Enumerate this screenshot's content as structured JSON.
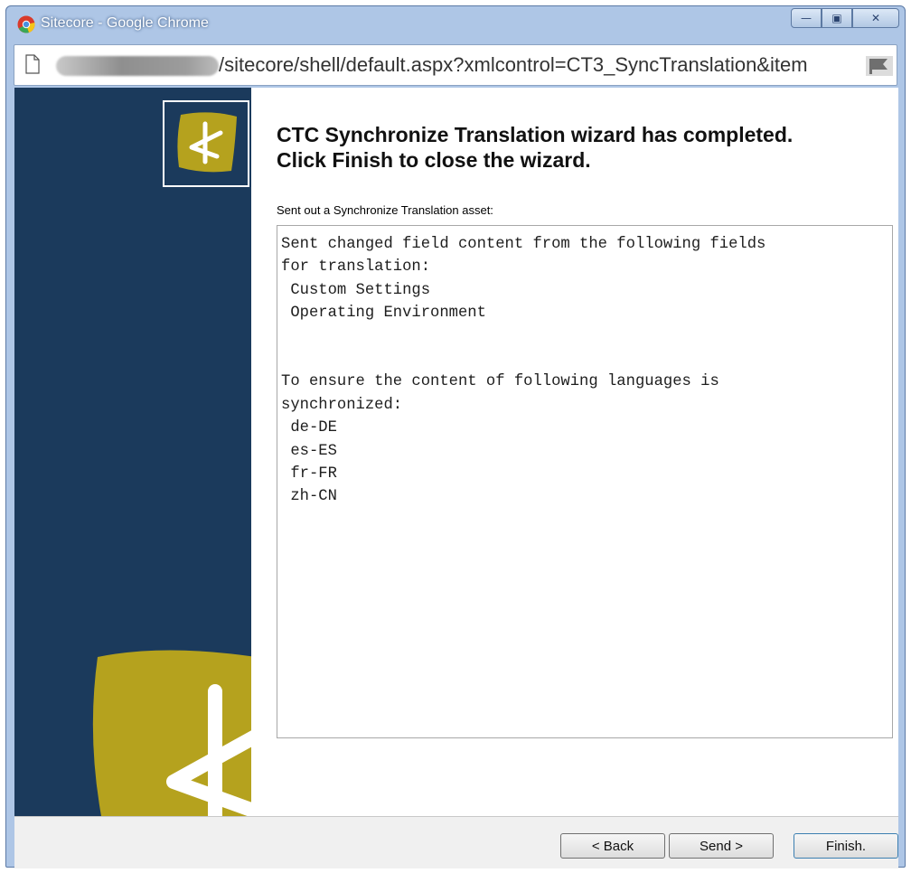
{
  "window": {
    "title": "Sitecore - Google Chrome",
    "controls": {
      "minimize": "—",
      "maximize": "▣",
      "close": "✕"
    }
  },
  "addressbar": {
    "url_visible": "/sitecore/shell/default.aspx?xmlcontrol=CT3_SyncTranslation&item"
  },
  "wizard": {
    "heading_line1": "CTC Synchronize Translation wizard has completed.",
    "heading_line2": "Click Finish to close the wizard.",
    "asset_label": "Sent out a Synchronize Translation asset:",
    "details": "Sent changed field content from the following fields\nfor translation:\n Custom Settings\n Operating Environment\n\n\nTo ensure the content of following languages is\nsynchronized:\n de-DE\n es-ES\n fr-FR\n zh-CN"
  },
  "footer": {
    "back_label": "< Back",
    "send_label": "Send >",
    "finish_label": "Finish."
  },
  "colors": {
    "sidebar": "#1b3a5c",
    "logo_gold": "#b5a21e",
    "window_frame": "#aec6e6"
  },
  "icons": {
    "browser": "chrome-logo-icon",
    "page": "page-icon",
    "app_logo": "sitecore-ctc-logo-icon"
  }
}
